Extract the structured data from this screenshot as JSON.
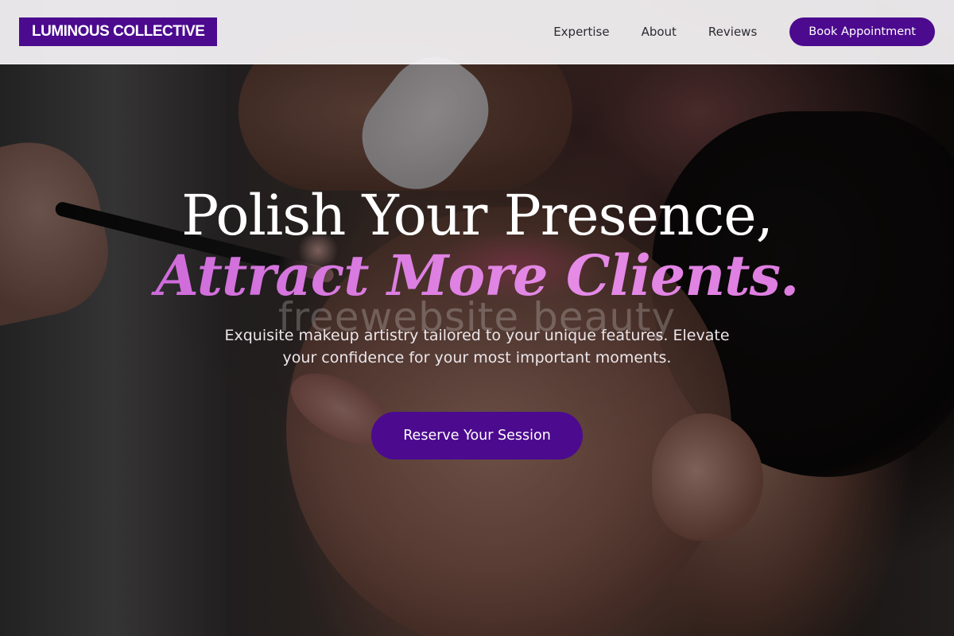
{
  "header": {
    "logo_text": "LUMINOUS COLLECTIVE",
    "nav": [
      {
        "label": "Expertise"
      },
      {
        "label": "About"
      },
      {
        "label": "Reviews"
      }
    ],
    "book_button_label": "Book Appointment"
  },
  "hero": {
    "headline_line1": "Polish Your Presence,",
    "headline_line2": "Attract More Clients.",
    "watermark_text": "freewebsite beauty",
    "subtitle": "Exquisite makeup artistry tailored to your unique features. Elevate your confidence for your most important moments.",
    "cta_label": "Reserve Your Session"
  },
  "colors": {
    "brand_purple": "#4c0a8f",
    "accent_pink": "#d872dc",
    "header_bg": "#f6f4f6"
  }
}
